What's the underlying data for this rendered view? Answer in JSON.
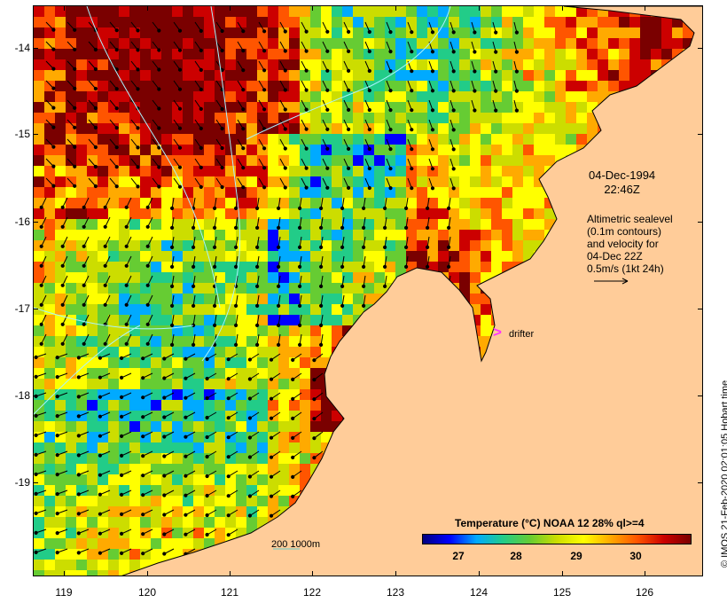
{
  "map": {
    "ylabels": [
      "-14",
      "-15",
      "-16",
      "-17",
      "-18",
      "-19"
    ],
    "xlabels": [
      "119",
      "120",
      "121",
      "122",
      "123",
      "124",
      "125",
      "126"
    ],
    "lat_range": [
      -20.1,
      -13.6
    ],
    "lon_range": [
      118.65,
      126.7
    ],
    "land_color": "#ffcc99",
    "coast_color": "#000000",
    "contour_color": "#aaf4ff"
  },
  "annotations": {
    "date": "04-Dec-1994",
    "time": "22:46Z",
    "altimetry_lines": [
      "Altimetric sealevel",
      "(0.1m contours)",
      "and velocity for",
      "04-Dec 22Z",
      "0.5m/s (1kt 24h)"
    ],
    "drifter_label": "drifter",
    "drifter_color": "#ff33ff",
    "depth_label": "200  1000m"
  },
  "colorbar": {
    "title": "Temperature (°C) NOAA 12 28% ql>=4",
    "ticks": [
      "27",
      "28",
      "29",
      "30"
    ],
    "colors": [
      "#000080",
      "#0000ff",
      "#00aaff",
      "#22cc88",
      "#66cc33",
      "#ccdd00",
      "#ffff00",
      "#ffaa00",
      "#ff5500",
      "#cc0000",
      "#7a0000"
    ]
  },
  "credit": "© IMOS 21-Feb-2020 02:01:05 Hobart time"
}
